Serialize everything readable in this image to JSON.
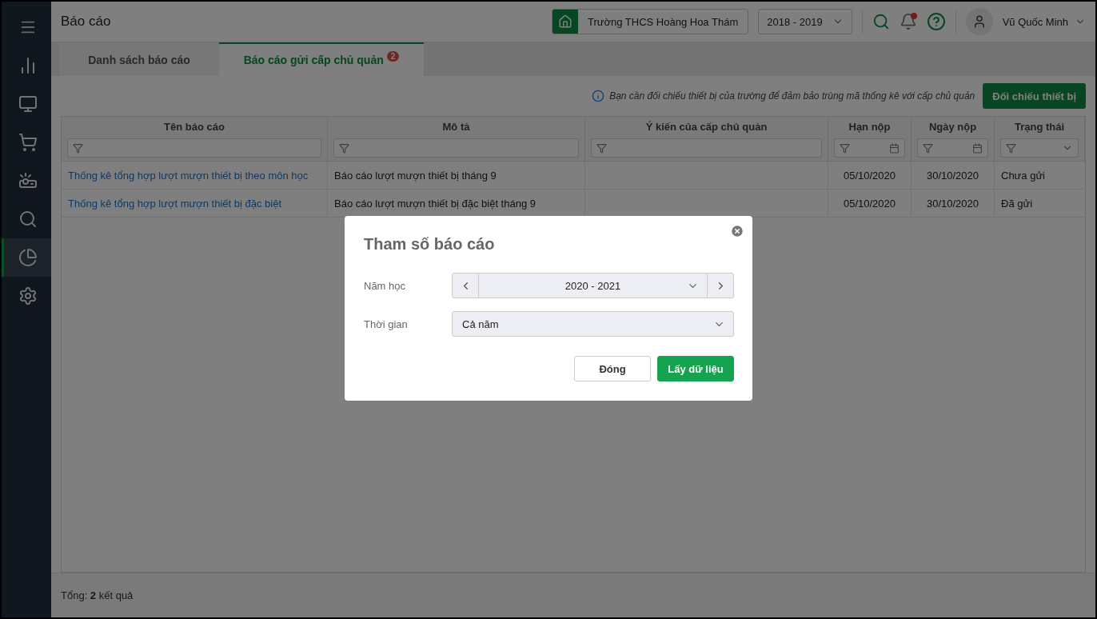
{
  "sidebar": {
    "items": [
      {
        "selected": false
      },
      {
        "selected": false
      },
      {
        "selected": false
      },
      {
        "selected": false
      },
      {
        "selected": false
      },
      {
        "selected": true
      },
      {
        "selected": false
      }
    ]
  },
  "header": {
    "title": "Báo cáo",
    "school": "Trường THCS Hoàng Hoa Thám",
    "year": "2018 - 2019",
    "notification_dot": true,
    "user": "Vũ Quốc Minh"
  },
  "tabs": [
    {
      "label": "Danh sách báo cáo",
      "selected": false
    },
    {
      "label": "Báo cáo gửi cấp chủ quản",
      "selected": true,
      "badge": "2"
    }
  ],
  "notice": {
    "text": "Bạn cần đối chiếu thiết bị của trường để đảm bảo trùng mã thống kê với cấp chủ quản",
    "button": "Đối chiếu thiết bị"
  },
  "table": {
    "columns": [
      {
        "label": "Tên báo cáo",
        "kind": "text"
      },
      {
        "label": "Mô tả",
        "kind": "text"
      },
      {
        "label": "Ý kiến của cấp chủ quản",
        "kind": "text"
      },
      {
        "label": "Hạn nộp",
        "kind": "date"
      },
      {
        "label": "Ngày nộp",
        "kind": "date"
      },
      {
        "label": "Trạng thái",
        "kind": "select"
      }
    ],
    "rows": [
      {
        "cells": [
          "Thống kê tổng hợp lượt mượn thiết bị theo môn học",
          "Báo cáo lượt mượn thiết bị tháng 9",
          "",
          "05/10/2020",
          "30/10/2020",
          "Chưa gửi"
        ]
      },
      {
        "cells": [
          "Thống kê tổng hợp lượt mượn thiết bị đặc biệt",
          "Báo cáo lượt mượn thiết bị đặc biệt tháng 9",
          "",
          "05/10/2020",
          "30/10/2020",
          "Đã gửi"
        ]
      }
    ]
  },
  "footer": "Tổng: **2** kết quả",
  "modal": {
    "title": "Tham số báo cáo",
    "fields": [
      {
        "label": "Năm học",
        "value": "2020 - 2021",
        "kind": "stepper"
      },
      {
        "label": "Thời gian",
        "value": "Cả năm",
        "kind": "select"
      }
    ],
    "buttons": [
      {
        "label": "Đóng",
        "kind": "secondary"
      },
      {
        "label": "Lấy dữ liệu",
        "kind": "primary"
      }
    ]
  }
}
